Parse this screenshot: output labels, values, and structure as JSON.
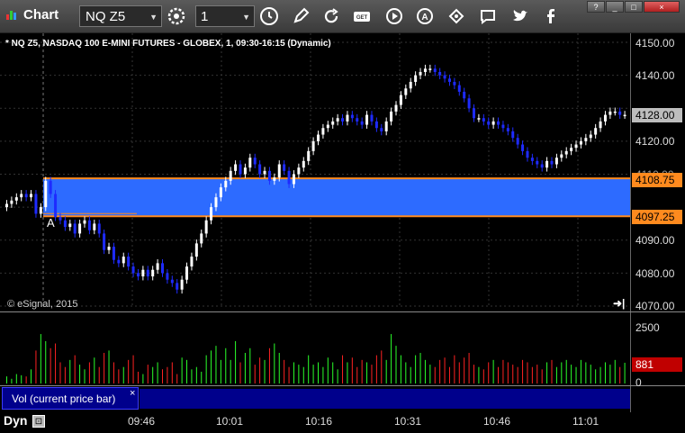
{
  "window": {
    "title": "Chart",
    "controls": [
      "?",
      "_",
      "□",
      "×"
    ]
  },
  "toolbar": {
    "symbol": "NQ Z5",
    "interval": "1",
    "icons": [
      "settings-icon",
      "clock-icon",
      "pencil-icon",
      "refresh-icon",
      "get-icon",
      "play-icon",
      "a-icon",
      "tag-icon",
      "chat-icon",
      "twitter-icon",
      "facebook-icon"
    ]
  },
  "chart": {
    "title": "* NQ Z5, NASDAQ 100 E-MINI FUTURES - GLOBEX, 1, 09:30-16:15 (Dynamic)",
    "watermark": "© eSignal, 2015",
    "marker_label": "A",
    "price_ticks": [
      "4150.00",
      "4140.00",
      "4130.00",
      "4120.00",
      "4110.00",
      "4100.00",
      "4090.00",
      "4080.00",
      "4070.00"
    ],
    "last_price": "4128.00",
    "band_high": "4108.75",
    "band_low": "4097.25",
    "band_color": "#2d6bff",
    "band_edge_color": "#ff8a1e",
    "up_color": "#ffffff",
    "down_color": "#1e2bff",
    "volume": {
      "label": "Vol (current price bar)",
      "close_label": "×",
      "ticks": [
        "2500",
        "0"
      ],
      "current": "881",
      "up_color": "#2aff2a",
      "down_color": "#ff2222"
    },
    "time_labels": [
      "09:46",
      "10:01",
      "10:16",
      "10:31",
      "10:46",
      "11:01"
    ],
    "mode": "Dyn"
  },
  "chart_data": {
    "type": "candlestick",
    "ylim": [
      4070,
      4150
    ],
    "closes": [
      4101,
      4102,
      4103,
      4104,
      4103,
      4104,
      4098,
      4100,
      4108,
      4104,
      4097,
      4096,
      4094,
      4095,
      4092,
      4095,
      4096,
      4093,
      4095,
      4092,
      4087,
      4088,
      4084,
      4083,
      4085,
      4082,
      4080,
      4079,
      4081,
      4079,
      4081,
      4083,
      4080,
      4078,
      4077,
      4075,
      4078,
      4082,
      4085,
      4089,
      4092,
      4096,
      4100,
      4103,
      4106,
      4108,
      4111,
      4113,
      4110,
      4112,
      4115,
      4113,
      4110,
      4111,
      4108,
      4109,
      4113,
      4111,
      4107,
      4110,
      4112,
      4114,
      4117,
      4120,
      4122,
      4124,
      4125,
      4126,
      4127,
      4126,
      4128,
      4127,
      4126,
      4125,
      4128,
      4126,
      4124,
      4123,
      4126,
      4129,
      4131,
      4134,
      4136,
      4138,
      4140,
      4141,
      4142,
      4142,
      4141,
      4140,
      4139,
      4138,
      4137,
      4135,
      4133,
      4130,
      4127,
      4127,
      4126,
      4125,
      4126,
      4125,
      4124,
      4123,
      4121,
      4119,
      4117,
      4115,
      4114,
      4113,
      4112,
      4114,
      4113,
      4115,
      4116,
      4117,
      4118,
      4119,
      4120,
      4121,
      4122,
      4124,
      4126,
      4128,
      4129,
      4129,
      4128,
      4128
    ],
    "volumes": [
      300,
      200,
      400,
      350,
      300,
      600,
      1400,
      2100,
      1800,
      1500,
      1700,
      900,
      700,
      1000,
      1200,
      800,
      600,
      900,
      1100,
      700,
      1300,
      1400,
      900,
      600,
      700,
      1000,
      1200,
      500,
      400,
      800,
      700,
      900,
      600,
      700,
      900,
      400,
      1100,
      1000,
      600,
      700,
      500,
      1200,
      1400,
      1600,
      1000,
      1500,
      1000,
      1800,
      900,
      1300,
      1500,
      800,
      1100,
      1000,
      1500,
      1700,
      1300,
      1000,
      700,
      900,
      800,
      700,
      1200,
      800,
      900,
      700,
      1100,
      900,
      600,
      1200,
      900,
      1100,
      700,
      1000,
      900,
      800,
      1200,
      1400,
      1000,
      2100,
      1600,
      1200,
      900,
      700,
      1200,
      1300,
      1000,
      800,
      700,
      1000,
      1100,
      700,
      1200,
      900,
      1100,
      1300,
      800,
      700,
      600,
      900,
      1000,
      700,
      1000,
      900,
      800,
      700,
      1000,
      900,
      700,
      800,
      600,
      900,
      1000,
      700,
      900,
      1000,
      800,
      700,
      1000,
      900,
      800,
      600,
      700,
      900,
      800,
      1000,
      700,
      881
    ]
  }
}
